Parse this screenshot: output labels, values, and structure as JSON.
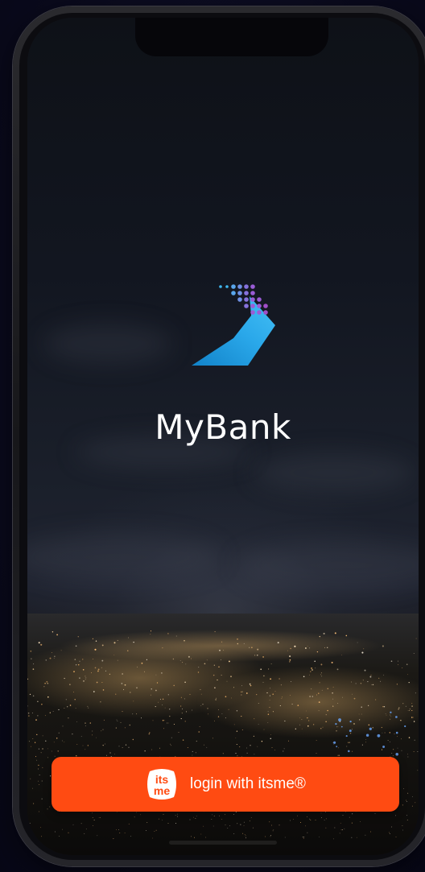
{
  "app": {
    "name": "MyBank"
  },
  "login": {
    "label": "login with itsme®",
    "badge_text_top": "its",
    "badge_text_bottom": "me",
    "icon": "itsme-logo-icon"
  },
  "brand": {
    "logo_icon": "mybank-logo-icon",
    "colors": {
      "accent_orange": "#ff4b12",
      "logo_blue": "#1fa0e0",
      "logo_cyan": "#3fb8f0",
      "logo_purple": "#9a5cd6"
    }
  }
}
